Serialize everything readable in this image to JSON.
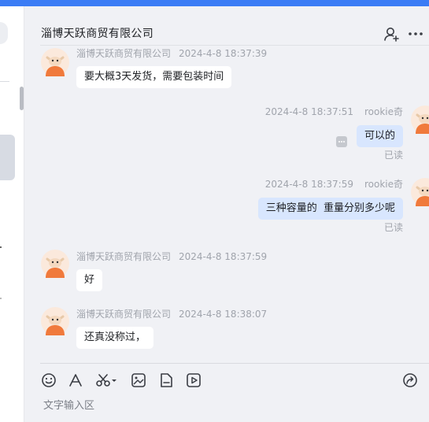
{
  "colors": {
    "accent": "#3b7cf5",
    "my_bubble": "#d8e6fe",
    "other_bubble": "#ffffff",
    "avatar_orange": "#f07a3c"
  },
  "chat": {
    "title": "淄博天跃商贸有限公司",
    "header_icons": [
      "add-contact-icon",
      "more-icon"
    ]
  },
  "messages": [
    {
      "sender": "淄博天跃商贸有限公司",
      "time": "2024-4-8 18:37:39",
      "text": "要大概3天发货，需要包装时间"
    },
    {
      "sender": "rookie奇",
      "time": "2024-4-8 18:37:51",
      "text": "可以的",
      "status": "已读"
    },
    {
      "sender": "rookie奇",
      "time": "2024-4-8 18:37:59",
      "text": "三种容量的  重量分别多少呢",
      "status": "已读"
    },
    {
      "sender": "淄博天跃商贸有限公司",
      "time": "2024-4-8 18:37:59",
      "text": "好"
    },
    {
      "sender": "淄博天跃商贸有限公司",
      "time": "2024-4-8 18:38:07",
      "text": "还真没称过，"
    }
  ],
  "composer": {
    "placeholder": "文字输入区",
    "tools": [
      "emoji-icon",
      "font-icon",
      "scissors-icon",
      "image-icon",
      "file-icon",
      "video-icon",
      "share-icon"
    ]
  }
}
